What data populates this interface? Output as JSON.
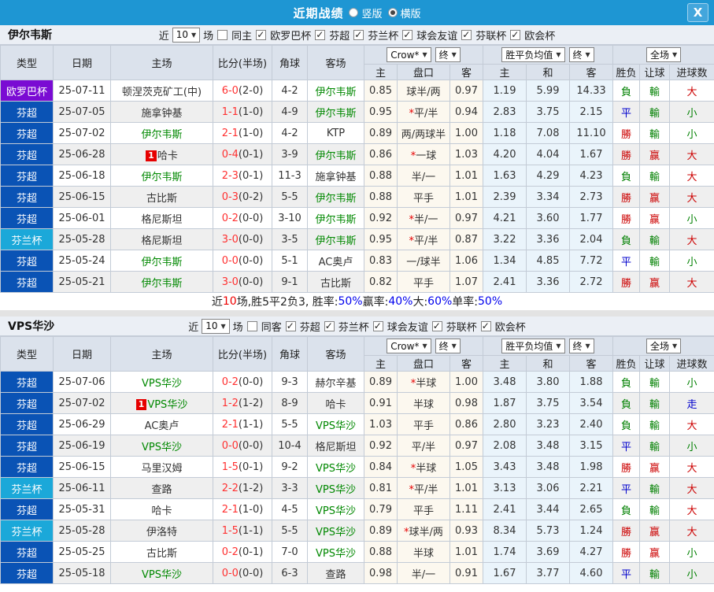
{
  "titlebar": {
    "title": "近期战绩",
    "options": [
      {
        "label": "竖版",
        "checked": false
      },
      {
        "label": "横版",
        "checked": true
      }
    ],
    "close": "X"
  },
  "header": {
    "static_cols": [
      "类型",
      "日期",
      "主场",
      "比分(半场)",
      "角球",
      "客场"
    ],
    "sub_cols": [
      "主",
      "盘口",
      "客",
      "主",
      "和",
      "客",
      "胜负",
      "让球",
      "进球数"
    ],
    "selects": {
      "odds_source": "Crow*",
      "odds_time": "终",
      "avg": "胜平负均值",
      "avg_time": "终",
      "scope": "全场"
    }
  },
  "filter_labels": {
    "recent": "近",
    "matches": "场"
  },
  "league_colors": {
    "欧罗巴杯": "#7A0BD3",
    "芬超": "#0A53B5",
    "芬兰杯": "#1BA8D9"
  },
  "result_colors": {
    "勝": "#CC0000",
    "赢": "#CC0000",
    "大": "#CC0000",
    "負": "#008000",
    "輸": "#008000",
    "小": "#008000",
    "平": "#0000CC",
    "走": "#0000CC"
  },
  "sections": [
    {
      "team": "伊尔韦斯",
      "count": "10",
      "same_label": "同主",
      "same_checked": false,
      "leagues": [
        "欧罗巴杯",
        "芬超",
        "芬兰杯",
        "球会友谊",
        "芬联杯",
        "欧会杯"
      ],
      "rows": [
        {
          "league": "欧罗巴杯",
          "date": "25-07-11",
          "home": "顿涅茨克矿工(中)",
          "home_green": false,
          "home_badge": "",
          "score": "6-0",
          "half": "(2-0)",
          "corners": "4-2",
          "away": "伊尔韦斯",
          "away_green": true,
          "o1": "0.85",
          "hc": "球半/两",
          "star": false,
          "o2": "0.97",
          "w": "1.19",
          "d": "5.99",
          "l": "14.33",
          "r1": "負",
          "r2": "輸",
          "r3": "大"
        },
        {
          "league": "芬超",
          "date": "25-07-05",
          "home": "施拿钟基",
          "home_green": false,
          "home_badge": "",
          "score": "1-1",
          "half": "(1-0)",
          "corners": "4-9",
          "away": "伊尔韦斯",
          "away_green": true,
          "o1": "0.95",
          "hc": "平/半",
          "star": true,
          "o2": "0.94",
          "w": "2.83",
          "d": "3.75",
          "l": "2.15",
          "r1": "平",
          "r2": "輸",
          "r3": "小"
        },
        {
          "league": "芬超",
          "date": "25-07-02",
          "home": "伊尔韦斯",
          "home_green": true,
          "home_badge": "",
          "score": "2-1",
          "half": "(1-0)",
          "corners": "4-2",
          "away": "KTP",
          "away_green": false,
          "o1": "0.89",
          "hc": "两/两球半",
          "star": false,
          "o2": "1.00",
          "w": "1.18",
          "d": "7.08",
          "l": "11.10",
          "r1": "勝",
          "r2": "輸",
          "r3": "小"
        },
        {
          "league": "芬超",
          "date": "25-06-28",
          "home": "哈卡",
          "home_green": false,
          "home_badge": "1",
          "score": "0-4",
          "half": "(0-1)",
          "corners": "3-9",
          "away": "伊尔韦斯",
          "away_green": true,
          "o1": "0.86",
          "hc": "一球",
          "star": true,
          "o2": "1.03",
          "w": "4.20",
          "d": "4.04",
          "l": "1.67",
          "r1": "勝",
          "r2": "赢",
          "r3": "大"
        },
        {
          "league": "芬超",
          "date": "25-06-18",
          "home": "伊尔韦斯",
          "home_green": true,
          "home_badge": "",
          "score": "2-3",
          "half": "(0-1)",
          "corners": "11-3",
          "away": "施拿钟基",
          "away_green": false,
          "o1": "0.88",
          "hc": "半/一",
          "star": false,
          "o2": "1.01",
          "w": "1.63",
          "d": "4.29",
          "l": "4.23",
          "r1": "負",
          "r2": "輸",
          "r3": "大"
        },
        {
          "league": "芬超",
          "date": "25-06-15",
          "home": "古比斯",
          "home_green": false,
          "home_badge": "",
          "score": "0-3",
          "half": "(0-2)",
          "corners": "5-5",
          "away": "伊尔韦斯",
          "away_green": true,
          "o1": "0.88",
          "hc": "平手",
          "star": false,
          "o2": "1.01",
          "w": "2.39",
          "d": "3.34",
          "l": "2.73",
          "r1": "勝",
          "r2": "赢",
          "r3": "大"
        },
        {
          "league": "芬超",
          "date": "25-06-01",
          "home": "格尼斯坦",
          "home_green": false,
          "home_badge": "",
          "score": "0-2",
          "half": "(0-0)",
          "corners": "3-10",
          "away": "伊尔韦斯",
          "away_green": true,
          "o1": "0.92",
          "hc": "半/一",
          "star": true,
          "o2": "0.97",
          "w": "4.21",
          "d": "3.60",
          "l": "1.77",
          "r1": "勝",
          "r2": "赢",
          "r3": "小"
        },
        {
          "league": "芬兰杯",
          "date": "25-05-28",
          "home": "格尼斯坦",
          "home_green": false,
          "home_badge": "",
          "score": "3-0",
          "half": "(0-0)",
          "corners": "3-5",
          "away": "伊尔韦斯",
          "away_green": true,
          "o1": "0.95",
          "hc": "平/半",
          "star": true,
          "o2": "0.87",
          "w": "3.22",
          "d": "3.36",
          "l": "2.04",
          "r1": "負",
          "r2": "輸",
          "r3": "大"
        },
        {
          "league": "芬超",
          "date": "25-05-24",
          "home": "伊尔韦斯",
          "home_green": true,
          "home_badge": "",
          "score": "0-0",
          "half": "(0-0)",
          "corners": "5-1",
          "away": "AC奥卢",
          "away_green": false,
          "o1": "0.83",
          "hc": "一/球半",
          "star": false,
          "o2": "1.06",
          "w": "1.34",
          "d": "4.85",
          "l": "7.72",
          "r1": "平",
          "r2": "輸",
          "r3": "小"
        },
        {
          "league": "芬超",
          "date": "25-05-21",
          "home": "伊尔韦斯",
          "home_green": true,
          "home_badge": "",
          "score": "3-0",
          "half": "(0-0)",
          "corners": "9-1",
          "away": "古比斯",
          "away_green": false,
          "o1": "0.82",
          "hc": "平手",
          "star": false,
          "o2": "1.07",
          "w": "2.41",
          "d": "3.36",
          "l": "2.72",
          "r1": "勝",
          "r2": "赢",
          "r3": "大"
        }
      ],
      "summary": [
        {
          "t": "近",
          "c": "dark"
        },
        {
          "t": "10",
          "c": "red"
        },
        {
          "t": "场,胜5平2负3, 胜率:",
          "c": "dark"
        },
        {
          "t": "50%",
          "c": "blue"
        },
        {
          "t": " 赢率:",
          "c": "dark"
        },
        {
          "t": "40%",
          "c": "blue"
        },
        {
          "t": " 大:",
          "c": "dark"
        },
        {
          "t": "60%",
          "c": "blue"
        },
        {
          "t": " 单率:",
          "c": "dark"
        },
        {
          "t": "50%",
          "c": "blue"
        }
      ]
    },
    {
      "team": "VPS华沙",
      "count": "10",
      "same_label": "同客",
      "same_checked": false,
      "leagues": [
        "芬超",
        "芬兰杯",
        "球会友谊",
        "芬联杯",
        "欧会杯"
      ],
      "rows": [
        {
          "league": "芬超",
          "date": "25-07-06",
          "home": "VPS华沙",
          "home_green": true,
          "home_badge": "",
          "score": "0-2",
          "half": "(0-0)",
          "corners": "9-3",
          "away": "赫尔辛基",
          "away_green": false,
          "o1": "0.89",
          "hc": "半球",
          "star": true,
          "o2": "1.00",
          "w": "3.48",
          "d": "3.80",
          "l": "1.88",
          "r1": "負",
          "r2": "輸",
          "r3": "小"
        },
        {
          "league": "芬超",
          "date": "25-07-02",
          "home": "VPS华沙",
          "home_green": true,
          "home_badge": "1",
          "score": "1-2",
          "half": "(1-2)",
          "corners": "8-9",
          "away": "哈卡",
          "away_green": false,
          "o1": "0.91",
          "hc": "半球",
          "star": false,
          "o2": "0.98",
          "w": "1.87",
          "d": "3.75",
          "l": "3.54",
          "r1": "負",
          "r2": "輸",
          "r3": "走"
        },
        {
          "league": "芬超",
          "date": "25-06-29",
          "home": "AC奥卢",
          "home_green": false,
          "home_badge": "",
          "score": "2-1",
          "half": "(1-1)",
          "corners": "5-5",
          "away": "VPS华沙",
          "away_green": true,
          "o1": "1.03",
          "hc": "平手",
          "star": false,
          "o2": "0.86",
          "w": "2.80",
          "d": "3.23",
          "l": "2.40",
          "r1": "負",
          "r2": "輸",
          "r3": "大"
        },
        {
          "league": "芬超",
          "date": "25-06-19",
          "home": "VPS华沙",
          "home_green": true,
          "home_badge": "",
          "score": "0-0",
          "half": "(0-0)",
          "corners": "10-4",
          "away": "格尼斯坦",
          "away_green": false,
          "o1": "0.92",
          "hc": "平/半",
          "star": false,
          "o2": "0.97",
          "w": "2.08",
          "d": "3.48",
          "l": "3.15",
          "r1": "平",
          "r2": "輸",
          "r3": "小"
        },
        {
          "league": "芬超",
          "date": "25-06-15",
          "home": "马里汉姆",
          "home_green": false,
          "home_badge": "",
          "score": "1-5",
          "half": "(0-1)",
          "corners": "9-2",
          "away": "VPS华沙",
          "away_green": true,
          "o1": "0.84",
          "hc": "半球",
          "star": true,
          "o2": "1.05",
          "w": "3.43",
          "d": "3.48",
          "l": "1.98",
          "r1": "勝",
          "r2": "赢",
          "r3": "大"
        },
        {
          "league": "芬兰杯",
          "date": "25-06-11",
          "home": "查路",
          "home_green": false,
          "home_badge": "",
          "score": "2-2",
          "half": "(1-2)",
          "corners": "3-3",
          "away": "VPS华沙",
          "away_green": true,
          "o1": "0.81",
          "hc": "平/半",
          "star": true,
          "o2": "1.01",
          "w": "3.13",
          "d": "3.06",
          "l": "2.21",
          "r1": "平",
          "r2": "輸",
          "r3": "大"
        },
        {
          "league": "芬超",
          "date": "25-05-31",
          "home": "哈卡",
          "home_green": false,
          "home_badge": "",
          "score": "2-1",
          "half": "(1-0)",
          "corners": "4-5",
          "away": "VPS华沙",
          "away_green": true,
          "o1": "0.79",
          "hc": "平手",
          "star": false,
          "o2": "1.11",
          "w": "2.41",
          "d": "3.44",
          "l": "2.65",
          "r1": "負",
          "r2": "輸",
          "r3": "大"
        },
        {
          "league": "芬兰杯",
          "date": "25-05-28",
          "home": "伊洛特",
          "home_green": false,
          "home_badge": "",
          "score": "1-5",
          "half": "(1-1)",
          "corners": "5-5",
          "away": "VPS华沙",
          "away_green": true,
          "o1": "0.89",
          "hc": "球半/两",
          "star": true,
          "o2": "0.93",
          "w": "8.34",
          "d": "5.73",
          "l": "1.24",
          "r1": "勝",
          "r2": "赢",
          "r3": "大"
        },
        {
          "league": "芬超",
          "date": "25-05-25",
          "home": "古比斯",
          "home_green": false,
          "home_badge": "",
          "score": "0-2",
          "half": "(0-1)",
          "corners": "7-0",
          "away": "VPS华沙",
          "away_green": true,
          "o1": "0.88",
          "hc": "半球",
          "star": false,
          "o2": "1.01",
          "w": "1.74",
          "d": "3.69",
          "l": "4.27",
          "r1": "勝",
          "r2": "赢",
          "r3": "小"
        },
        {
          "league": "芬超",
          "date": "25-05-18",
          "home": "VPS华沙",
          "home_green": true,
          "home_badge": "",
          "score": "0-0",
          "half": "(0-0)",
          "corners": "6-3",
          "away": "查路",
          "away_green": false,
          "o1": "0.98",
          "hc": "半/一",
          "star": false,
          "o2": "0.91",
          "w": "1.67",
          "d": "3.77",
          "l": "4.60",
          "r1": "平",
          "r2": "輸",
          "r3": "小"
        }
      ],
      "summary": null
    }
  ]
}
